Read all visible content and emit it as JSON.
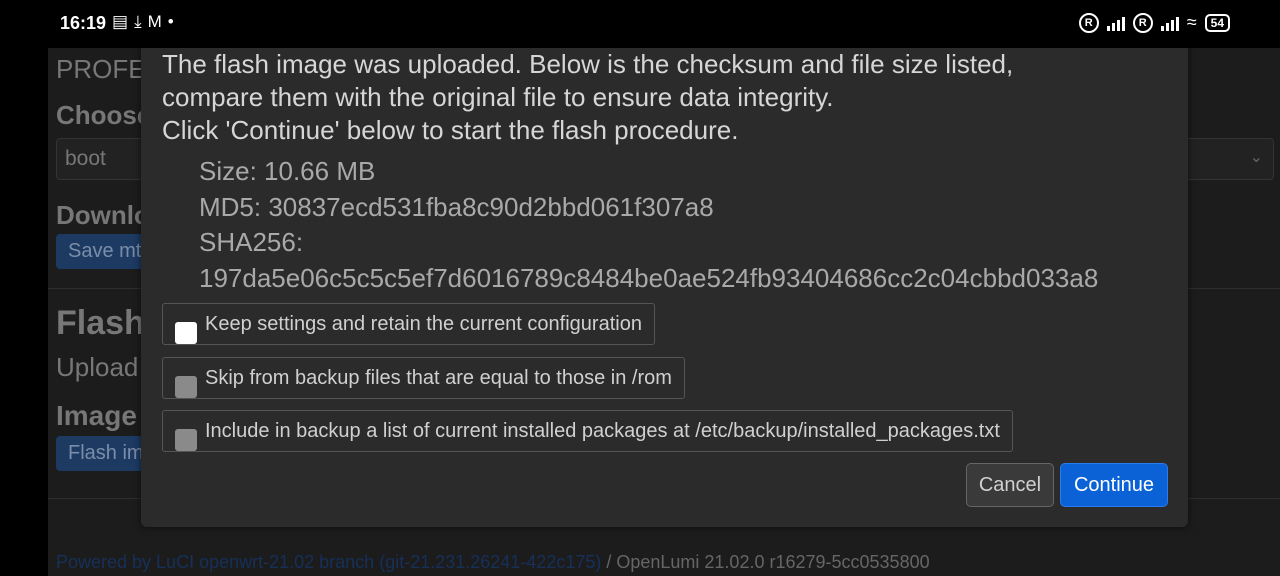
{
  "status_bar": {
    "time": "16:19",
    "left_icons": [
      "notes-icon",
      "download-icon",
      "gmail-icon",
      "dot-icon"
    ],
    "battery": "54"
  },
  "background": {
    "profile_heading": "PROFE",
    "choose_label": "Choose",
    "select_value": "boot",
    "download_heading": "Downlo",
    "save_button": "Save mt",
    "flash_heading": "Flash",
    "upload_text": "Upload",
    "image_heading": "Image",
    "flash_button": "Flash im",
    "footer_link": "Powered by LuCI openwrt-21.02 branch (git-21.231.26241-422c175)",
    "footer_text": " / OpenLumi 21.02.0 r16279-5cc0535800"
  },
  "modal": {
    "message_line1": "The flash image was uploaded. Below is the checksum and file size listed,",
    "message_line2": "compare them with the original file to ensure data integrity.",
    "message_line3": "Click 'Continue' below to start the flash procedure.",
    "size": "Size: 10.66 MB",
    "md5": "MD5: 30837ecd531fba8c90d2bbd061f307a8",
    "sha256_label": "SHA256:",
    "sha256_value": "197da5e06c5c5c5ef7d6016789c8484be0ae524fb93404686cc2c04cbbd033a8",
    "options": [
      {
        "label": "Keep settings and retain the current configuration",
        "checked": true
      },
      {
        "label": "Skip from backup files that are equal to those in /rom",
        "checked": false
      },
      {
        "label": "Include in backup a list of current installed packages at /etc/backup/installed_packages.txt",
        "checked": false
      }
    ],
    "cancel_label": "Cancel",
    "continue_label": "Continue"
  },
  "colors": {
    "primary_button": "#0a62d6",
    "modal_bg": "#2b2b2b"
  }
}
